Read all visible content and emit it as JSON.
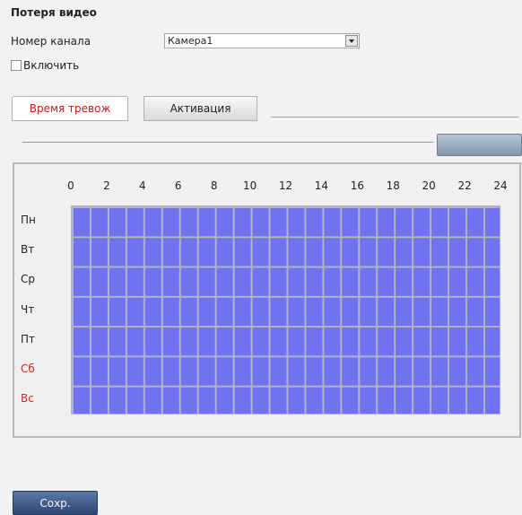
{
  "title": "Потеря видео",
  "channel": {
    "label": "Номер канала",
    "selected": "Камера1"
  },
  "enable": {
    "label": "Включить",
    "checked": false
  },
  "tabs": [
    {
      "label": "Время тревож",
      "active": true
    },
    {
      "label": "Активация",
      "active": false
    }
  ],
  "schedule": {
    "hours": [
      "0",
      "2",
      "4",
      "6",
      "8",
      "10",
      "12",
      "14",
      "16",
      "18",
      "20",
      "22",
      "24"
    ],
    "days": [
      {
        "label": "Пн",
        "weekend": false
      },
      {
        "label": "Вт",
        "weekend": false
      },
      {
        "label": "Ср",
        "weekend": false
      },
      {
        "label": "Чт",
        "weekend": false
      },
      {
        "label": "Пт",
        "weekend": false
      },
      {
        "label": "Сб",
        "weekend": true
      },
      {
        "label": "Вс",
        "weekend": true
      }
    ],
    "fill_color": "#7072f1",
    "all_hours_selected": true
  },
  "save_label": "Сохр.",
  "colors": {
    "accent_red": "#cc1a1a",
    "weekend_red": "#e02020",
    "button_blue": "#3d5a88"
  }
}
